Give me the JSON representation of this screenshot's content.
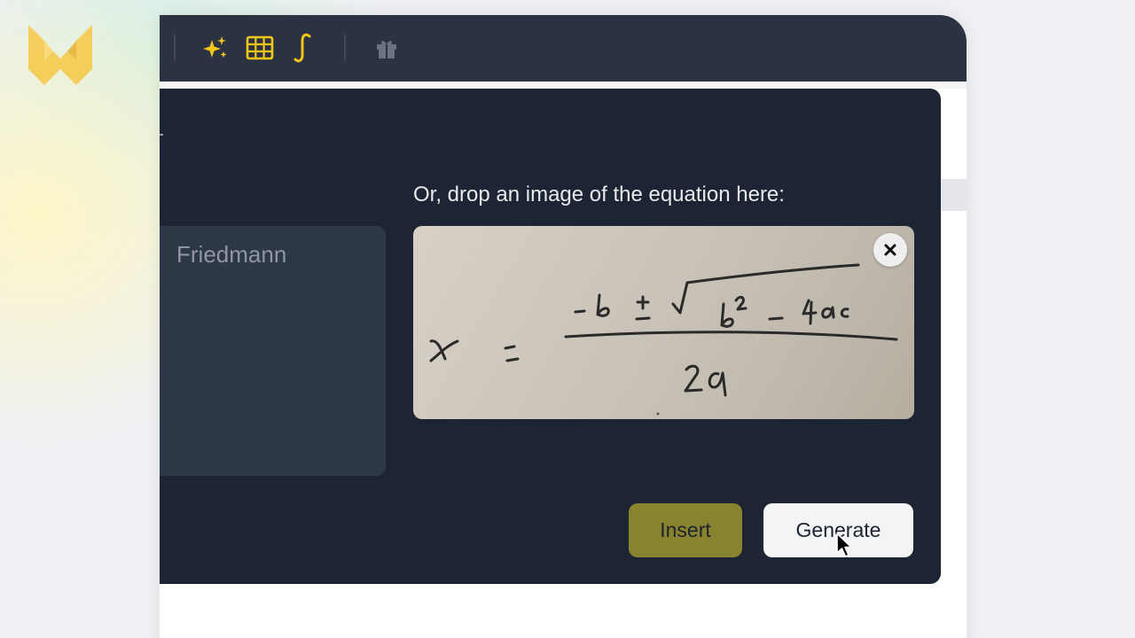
{
  "logo": {
    "icon": "w-logo-icon",
    "color": "#f6c744"
  },
  "toolbar": {
    "background": "#2b3342",
    "icons": [
      "sparkles-icon",
      "table-icon",
      "integral-icon",
      "gift-icon"
    ],
    "accent": "#f5c518"
  },
  "dialog": {
    "name_field": {
      "value": "Friedmann"
    },
    "drop_label": "Or, drop an image of the equation here:",
    "image": {
      "equation": "x = (-b ± √(b² - 4ac)) / 2a"
    },
    "insert_label": "Insert",
    "generate_label": "Generate",
    "colors": {
      "dialog_bg": "#1d2433",
      "insert_bg": "#898330",
      "generate_bg": "#f3f4f6"
    }
  }
}
